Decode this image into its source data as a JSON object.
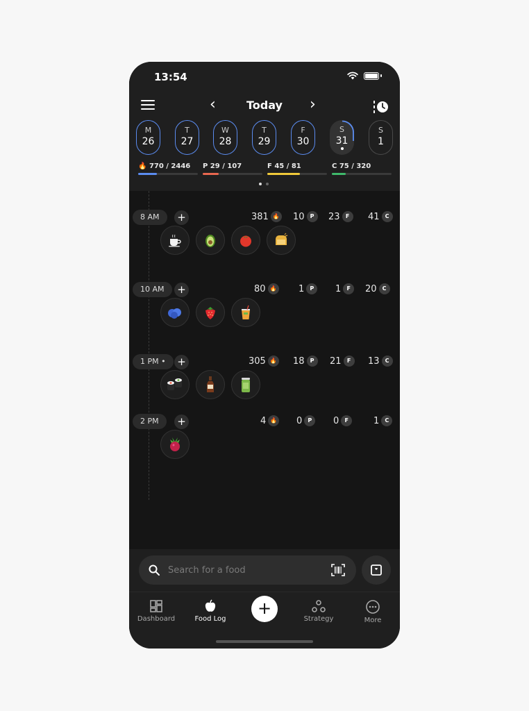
{
  "status": {
    "time": "13:54"
  },
  "header": {
    "title": "Today"
  },
  "days": [
    {
      "letter": "M",
      "num": "26"
    },
    {
      "letter": "T",
      "num": "27"
    },
    {
      "letter": "W",
      "num": "28"
    },
    {
      "letter": "T",
      "num": "29"
    },
    {
      "letter": "F",
      "num": "30"
    },
    {
      "letter": "S",
      "num": "31"
    },
    {
      "letter": "S",
      "num": "1"
    }
  ],
  "macros": {
    "cal": {
      "label": "770 / 2446",
      "progress": 0.315,
      "color": "#5b8cf0"
    },
    "p": {
      "label": "P 29 / 107",
      "progress": 0.27,
      "color": "#e8674f"
    },
    "f": {
      "label": "F 45 / 81",
      "progress": 0.55,
      "color": "#f0c93a"
    },
    "c": {
      "label": "C 75 / 320",
      "progress": 0.23,
      "color": "#3fb96b"
    }
  },
  "badges": {
    "p": "P",
    "f": "F",
    "c": "C"
  },
  "meals": [
    {
      "time": "8 AM",
      "cal": "381",
      "p": "10",
      "f": "23",
      "c": "41"
    },
    {
      "time": "10 AM",
      "cal": "80",
      "p": "1",
      "f": "1",
      "c": "20"
    },
    {
      "time": "1 PM",
      "cal": "305",
      "p": "18",
      "f": "21",
      "c": "13"
    },
    {
      "time": "2 PM",
      "cal": "4",
      "p": "0",
      "f": "0",
      "c": "1"
    }
  ],
  "search": {
    "placeholder": "Search for a food"
  },
  "tabs": {
    "dashboard": "Dashboard",
    "foodlog": "Food Log",
    "strategy": "Strategy",
    "more": "More",
    "add": "+"
  }
}
